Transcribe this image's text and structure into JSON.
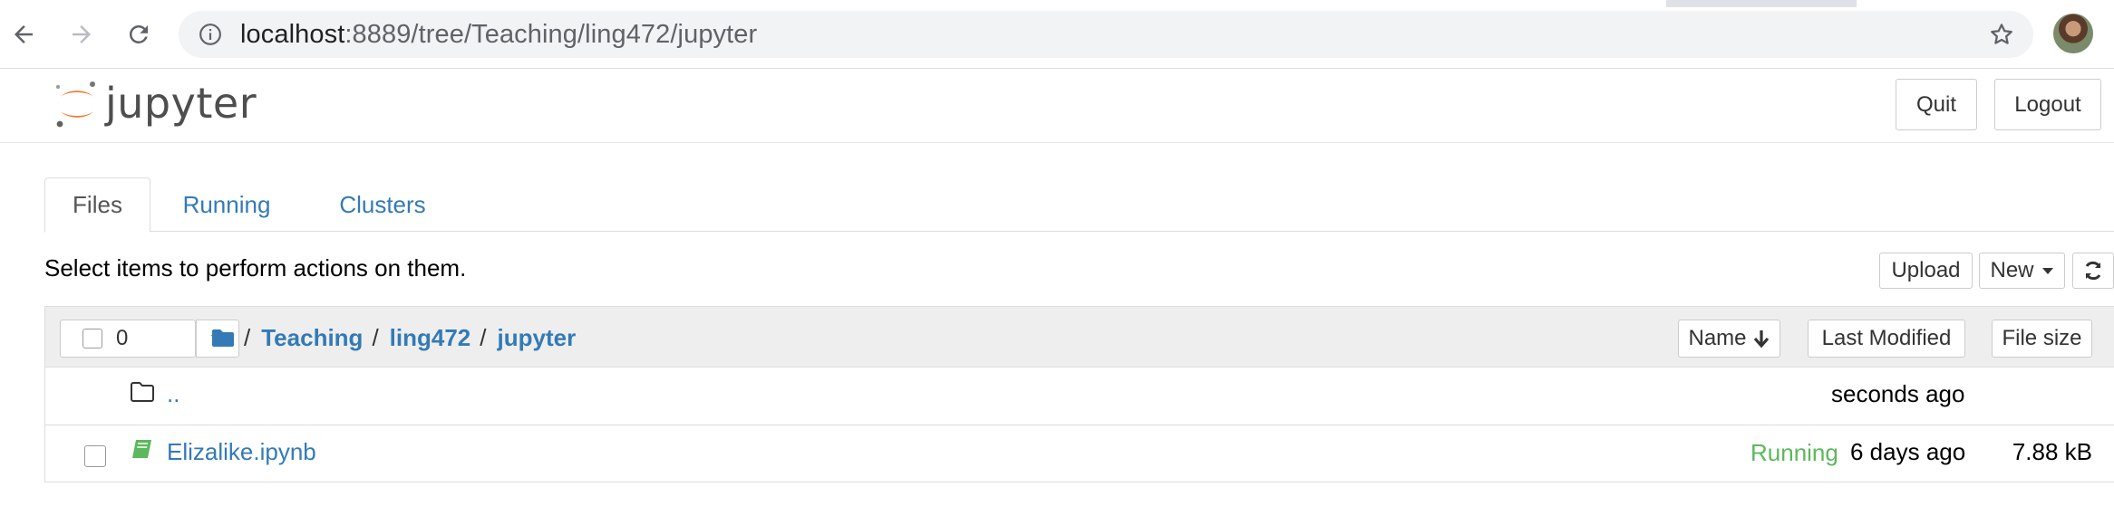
{
  "browser": {
    "url_host": "localhost",
    "url_rest": ":8889/tree/Teaching/ling472/jupyter",
    "back_icon": "back-arrow-icon",
    "forward_icon": "forward-arrow-icon",
    "reload_icon": "reload-icon",
    "info_icon": "info-icon",
    "bookmark_icon": "star-icon"
  },
  "header": {
    "logo_text": "jupyter",
    "quit_label": "Quit",
    "logout_label": "Logout"
  },
  "tabs": [
    {
      "label": "Files",
      "active": true
    },
    {
      "label": "Running",
      "active": false
    },
    {
      "label": "Clusters",
      "active": false
    }
  ],
  "toolbar": {
    "instructions": "Select items to perform actions on them.",
    "upload_label": "Upload",
    "new_label": "New",
    "refresh_icon": "refresh-icon"
  },
  "list": {
    "selected_count": "0",
    "breadcrumb": [
      "Teaching",
      "ling472",
      "jupyter"
    ],
    "sort": {
      "name_label": "Name",
      "modified_label": "Last Modified",
      "size_label": "File size"
    },
    "rows": [
      {
        "name": "..",
        "icon": "folder-icon",
        "status": "",
        "modified": "seconds ago",
        "size": ""
      },
      {
        "name": "Elizalike.ipynb",
        "icon": "notebook-icon",
        "status": "Running",
        "modified": "6 days ago",
        "size": "7.88 kB"
      }
    ]
  },
  "colors": {
    "link": "#337ab7",
    "running": "#5cb85c",
    "jupyter_orange": "#f37726"
  }
}
